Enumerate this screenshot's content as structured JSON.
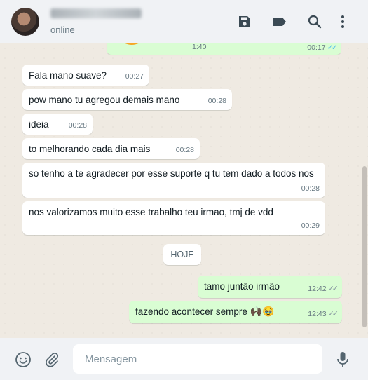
{
  "header": {
    "status": "online",
    "icons": [
      "save-icon",
      "label-icon",
      "search-icon",
      "menu-icon"
    ]
  },
  "chat": {
    "top_message": {
      "middle_time": "1:40",
      "time": "00:17"
    },
    "incoming": [
      {
        "text": "Fala mano suave?",
        "time": "00:27"
      },
      {
        "text": "pow mano tu agregou demais mano",
        "time": "00:28"
      },
      {
        "text": "ideia",
        "time": "00:28"
      },
      {
        "text": "to melhorando cada dia mais",
        "time": "00:28"
      },
      {
        "text": "so tenho a te agradecer por esse suporte q tu tem dado a todos nos",
        "time": "00:28"
      },
      {
        "text": "nos valorizamos muito esse trabalho teu irmao, tmj de vdd",
        "time": "00:29"
      }
    ],
    "date_divider": "HOJE",
    "outgoing": [
      {
        "text": "tamo juntão irmão",
        "time": "12:42"
      },
      {
        "text": "fazendo acontecer sempre",
        "emoji": "🙌🏿🥹",
        "time": "12:43"
      }
    ]
  },
  "footer": {
    "placeholder": "Mensagem"
  }
}
